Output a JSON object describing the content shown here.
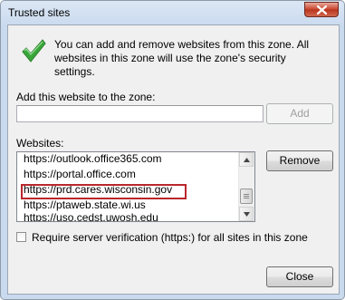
{
  "window": {
    "title": "Trusted sites"
  },
  "intro": {
    "text": "You can add and remove websites from this zone. All websites in this zone will use the zone's security settings."
  },
  "add_site": {
    "label": "Add this website to the zone:",
    "value": "",
    "button_label": "Add"
  },
  "websites": {
    "label": "Websites:",
    "items": [
      "https://outlook.office365.com",
      "https://portal.office.com",
      "https://prd.cares.wisconsin.gov",
      "https://ptaweb.state.wi.us",
      "https://uso.cedst.uwosh.edu"
    ],
    "highlighted": "https://prd.cares.wisconsin.gov",
    "remove_label": "Remove"
  },
  "verification": {
    "label": "Require server verification (https:) for all sites in this zone",
    "checked": false
  },
  "footer": {
    "close_label": "Close"
  },
  "colors": {
    "highlight_border": "#b9272c",
    "check_green": "#3aa63a",
    "close_button": "#c7432a"
  }
}
